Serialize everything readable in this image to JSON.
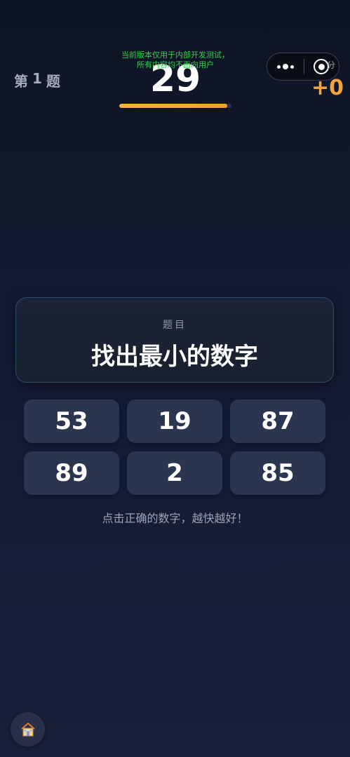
{
  "header": {
    "question_prefix": "第",
    "question_number": "1",
    "question_suffix": "题",
    "timer": "29",
    "timer_progress": 0.96,
    "score_label": "分",
    "score_delta": "+0"
  },
  "dev_notice": {
    "line1": "当前版本仅用于内部开发测试，",
    "line2": "所有内容均不面向用户"
  },
  "question": {
    "label": "题目",
    "text": "找出最小的数字"
  },
  "options": [
    "53",
    "19",
    "87",
    "89",
    "2",
    "85"
  ],
  "hint": "点击正确的数字，越快越好！",
  "icons": {
    "capsule_more": "more-dots-icon",
    "capsule_close": "close-target-icon",
    "home": "home-icon"
  },
  "colors": {
    "accent": "#f4a53a",
    "dev_notice": "#2fd14a",
    "button_bg": "#2a3550",
    "card_border": "#2e4a66"
  }
}
